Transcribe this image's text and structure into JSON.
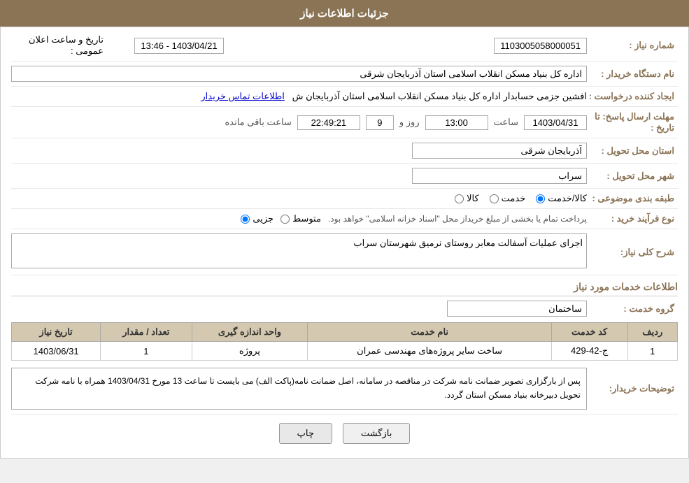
{
  "header": {
    "title": "جزئیات اطلاعات نیاز"
  },
  "fields": {
    "need_number_label": "شماره نیاز :",
    "need_number_value": "1103005058000051",
    "buyer_org_label": "نام دستگاه خریدار :",
    "buyer_org_value": "اداره کل بنیاد مسکن انقلاب اسلامی استان آذربایجان شرقی",
    "creator_label": "ایجاد کننده درخواست :",
    "creator_value": "افشین جزمی حسابدار اداره کل بنیاد مسکن انقلاب اسلامی استان آذربایجان ش",
    "creator_link": "اطلاعات تماس خریدار",
    "deadline_label": "مهلت ارسال پاسخ: تا تاریخ :",
    "deadline_date": "1403/04/31",
    "deadline_time_label": "ساعت",
    "deadline_time_value": "13:00",
    "deadline_days_label": "روز و",
    "deadline_days_value": "9",
    "deadline_remaining_label": "ساعت باقی مانده",
    "deadline_remaining_value": "22:49:21",
    "announce_label": "تاریخ و ساعت اعلان عمومی :",
    "announce_value": "1403/04/21 - 13:46",
    "province_label": "استان محل تحویل :",
    "province_value": "آذربایجان شرقی",
    "city_label": "شهر محل تحویل :",
    "city_value": "سراب",
    "category_label": "طبقه بندی موضوعی :",
    "category_kala": "کالا",
    "category_khedmat": "خدمت",
    "category_kala_khedmat": "کالا/خدمت",
    "category_selected": "kala_khedmat",
    "process_label": "نوع فرآیند خرید :",
    "process_jazii": "جزیی",
    "process_mutavassit": "متوسط",
    "process_description": "پرداخت تمام یا بخشی از مبلغ خریداز محل \"اسناد خزانه اسلامی\" خواهد بود.",
    "description_label": "شرح کلی نیاز:",
    "description_value": "اجرای عملیات آسفالت معابر روستای نرمیق شهرستان سراب",
    "services_section_title": "اطلاعات خدمات مورد نیاز",
    "service_group_label": "گروه خدمت :",
    "service_group_value": "ساختمان",
    "table_headers": [
      "ردیف",
      "کد خدمت",
      "نام خدمت",
      "واحد اندازه گیری",
      "تعداد / مقدار",
      "تاریخ نیاز"
    ],
    "table_rows": [
      {
        "row": "1",
        "code": "ج-42-429",
        "name": "ساخت سایر پروژه‌های مهندسی عمران",
        "unit": "پروژه",
        "quantity": "1",
        "date": "1403/06/31"
      }
    ],
    "notes_label": "توضیحات خریدار:",
    "notes_value": "پس از بارگزاری تصویر ضمانت نامه شرکت در مناقصه در سامانه، اصل ضمانت نامه(پاکت الف) می بایست تا ساعت 13 مورخ 1403/04/31 همراه با نامه شرکت تحویل دبیرخانه بنیاد مسکن استان گردد.",
    "btn_back": "بازگشت",
    "btn_print": "چاپ"
  },
  "colors": {
    "header_bg": "#8B7355",
    "label_color": "#8B7355",
    "table_header_bg": "#d4c9b0"
  }
}
